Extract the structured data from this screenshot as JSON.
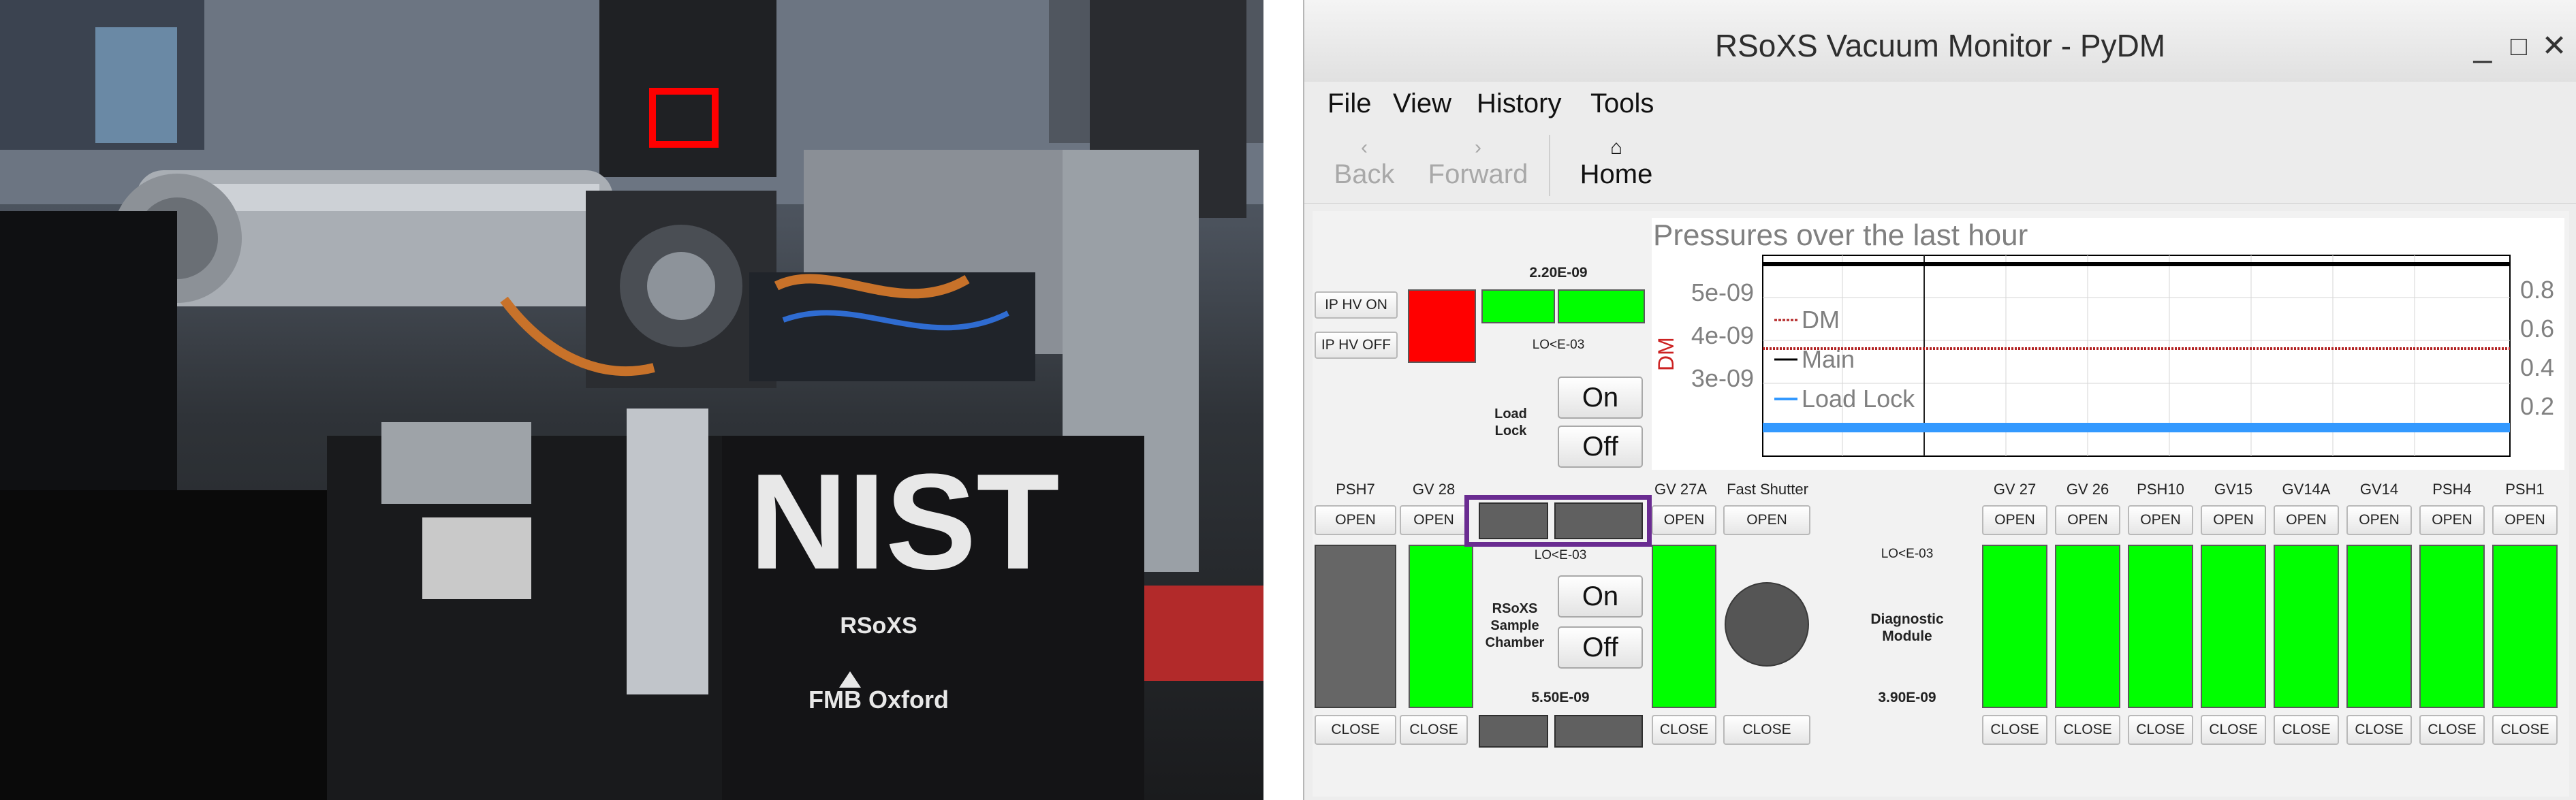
{
  "photo": {
    "nist_logo": "NIST",
    "label_rsoxs": "RSoXS",
    "label_vendor": "FMB Oxford"
  },
  "window": {
    "title": "RSoXS Vacuum Monitor - PyDM",
    "controls": {
      "minimize": "_",
      "maximize": "□",
      "close": "✕"
    }
  },
  "menu": [
    "File",
    "View",
    "History",
    "Tools"
  ],
  "toolbar": {
    "back": {
      "label": "Back",
      "icon": "chevron-left-icon"
    },
    "forward": {
      "label": "Forward",
      "icon": "chevron-right-icon"
    },
    "home": {
      "label": "Home",
      "icon": "home-icon"
    }
  },
  "load_lock": {
    "ip_hv_on": "IP HV ON",
    "ip_hv_off": "IP HV OFF",
    "pressure_top": "2.20E-09",
    "pressure_low": "LO<E-03",
    "label": "Load\nLock",
    "on": "On",
    "off": "Off",
    "colors": {
      "ion_pump": "#ff0000",
      "gauge": "#00ff00"
    }
  },
  "plot": {
    "title": "Pressures over the last hour",
    "ylabel": "DM",
    "left_ticks": [
      "5e-09",
      "4e-09",
      "3e-09"
    ],
    "right_ticks": [
      "0.8",
      "0.6",
      "0.4",
      "0.2"
    ],
    "legend": [
      {
        "name": "DM",
        "color": "#b22222"
      },
      {
        "name": "Main",
        "color": "#000000"
      },
      {
        "name": "Load Lock",
        "color": "#3399ff"
      }
    ]
  },
  "valves": {
    "open_label": "OPEN",
    "close_label": "CLOSE",
    "left_group": [
      "PSH7",
      "GV 28"
    ],
    "middle_group": [
      "GV 27A",
      "Fast Shutter"
    ],
    "right_group": [
      "GV 27",
      "GV 26",
      "PSH10",
      "GV15",
      "GV14A",
      "GV14",
      "PSH4",
      "PSH1"
    ],
    "states": {
      "PSH7": "gray",
      "GV 28": "green",
      "GV 27A": "green",
      "GV 27": "green",
      "GV 26": "green",
      "PSH10": "green",
      "GV15": "green",
      "GV14A": "green",
      "GV14": "green",
      "PSH4": "green",
      "PSH1": "green"
    }
  },
  "sample_chamber": {
    "label": "RSoXS\nSample\nChamber",
    "pressure_low": "LO<E-03",
    "pressure_bottom": "5.50E-09",
    "on": "On",
    "off": "Off"
  },
  "diagnostic_module": {
    "pressure_low": "LO<E-03",
    "label": "Diagnostic\nModule",
    "pressure": "3.90E-09"
  },
  "highlight_colors": {
    "photo_box": "#ff0000",
    "ui_box": "#6a2c91"
  }
}
